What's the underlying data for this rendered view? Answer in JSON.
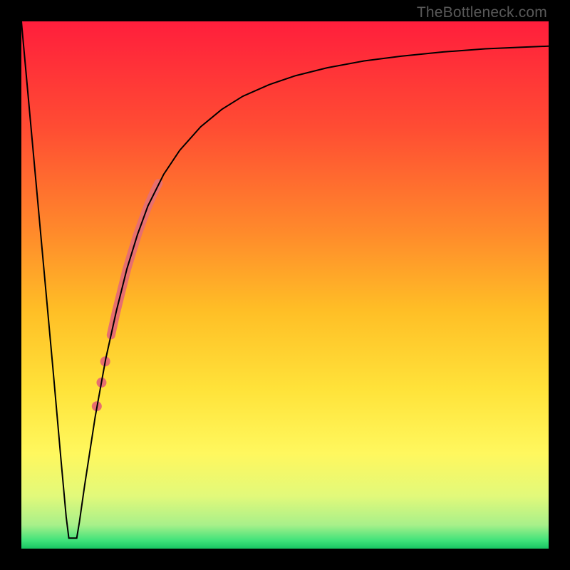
{
  "watermark": "TheBottleneck.com",
  "chart_data": {
    "type": "line",
    "title": "",
    "xlabel": "",
    "ylabel": "",
    "xlim": [
      0,
      100
    ],
    "ylim": [
      0,
      100
    ],
    "grid": false,
    "legend": false,
    "background_gradient_stops": [
      {
        "offset": 0.0,
        "color": "#ff1e3c"
      },
      {
        "offset": 0.2,
        "color": "#ff4c33"
      },
      {
        "offset": 0.4,
        "color": "#ff8a2b"
      },
      {
        "offset": 0.55,
        "color": "#ffbf26"
      },
      {
        "offset": 0.7,
        "color": "#ffe33a"
      },
      {
        "offset": 0.82,
        "color": "#fff85e"
      },
      {
        "offset": 0.9,
        "color": "#e2f97a"
      },
      {
        "offset": 0.955,
        "color": "#a8f08a"
      },
      {
        "offset": 0.985,
        "color": "#3ee27a"
      },
      {
        "offset": 1.0,
        "color": "#18c562"
      }
    ],
    "series": [
      {
        "name": "bottleneck-curve",
        "color": "#000000",
        "stroke_width": 2,
        "x": [
          0.0,
          2.0,
          4.0,
          6.0,
          7.5,
          8.5,
          9.0,
          9.5,
          10.5,
          11.0,
          12.0,
          14.0,
          16.0,
          18.0,
          20.0,
          22.0,
          24.0,
          27.0,
          30.0,
          34.0,
          38.0,
          42.0,
          47.0,
          52.0,
          58.0,
          65.0,
          72.0,
          80.0,
          88.0,
          95.0,
          100.0
        ],
        "y": [
          100.0,
          78.0,
          56.0,
          34.0,
          17.0,
          6.0,
          2.0,
          2.0,
          2.0,
          5.0,
          12.0,
          25.0,
          36.0,
          45.0,
          53.0,
          59.5,
          65.0,
          71.0,
          75.5,
          80.0,
          83.3,
          85.8,
          88.0,
          89.7,
          91.2,
          92.5,
          93.4,
          94.2,
          94.8,
          95.1,
          95.3
        ]
      }
    ],
    "highlight_segment": {
      "name": "highlight-band",
      "color": "#e76f6f",
      "width": 12,
      "x": [
        17.0,
        18.0,
        19.0,
        20.0,
        21.0,
        22.0,
        23.0,
        24.0,
        25.0,
        26.0
      ],
      "y": [
        40.5,
        45.0,
        49.0,
        53.0,
        56.3,
        59.5,
        62.3,
        65.0,
        67.3,
        69.3
      ]
    },
    "highlight_dots": {
      "name": "highlight-dots",
      "color": "#e76f6f",
      "radius": 7,
      "points": [
        {
          "x": 15.2,
          "y": 31.5
        },
        {
          "x": 15.9,
          "y": 35.5
        },
        {
          "x": 14.3,
          "y": 27.0
        }
      ]
    }
  }
}
